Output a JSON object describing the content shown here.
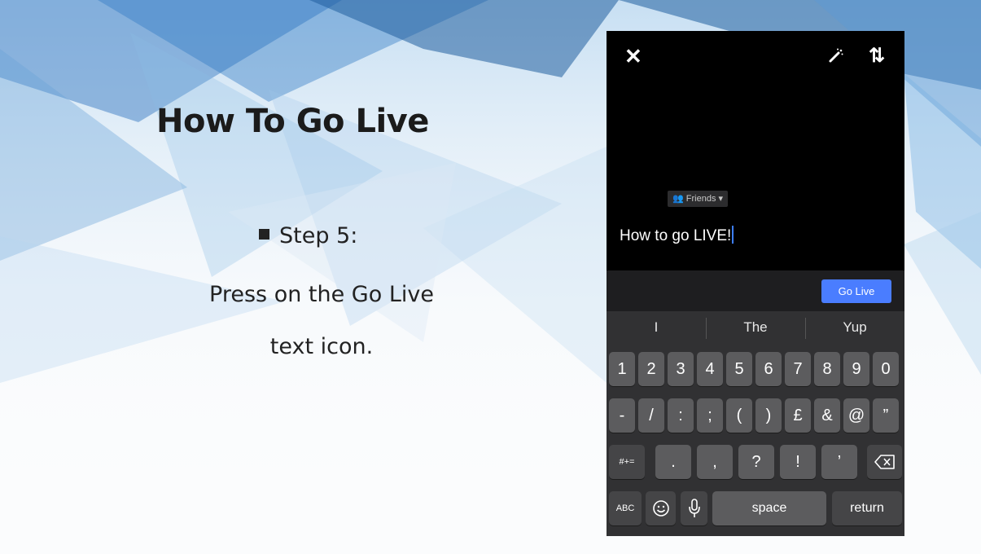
{
  "slide": {
    "title": "How To Go Live",
    "step_label": "Step 5:",
    "instruction_line1": "Press on the Go Live",
    "instruction_line2": "text icon."
  },
  "phone": {
    "audience_label": "Friends ▾",
    "caption_text": "How to go LIVE!",
    "go_live_label": "Go Live",
    "suggestions": [
      "I",
      "The",
      "Yup"
    ],
    "keyboard": {
      "row1": [
        "1",
        "2",
        "3",
        "4",
        "5",
        "6",
        "7",
        "8",
        "9",
        "0"
      ],
      "row2": [
        "-",
        "/",
        ":",
        ";",
        "(",
        ")",
        "£",
        "&",
        "@",
        "”"
      ],
      "row3_left": "#+=",
      "row3": [
        ".",
        ",",
        "?",
        "!",
        "’"
      ],
      "abc_label": "ABC",
      "space_label": "space",
      "return_label": "return"
    }
  },
  "colors": {
    "accent": "#4a7dff",
    "background_blue": "#2f79c4",
    "keyboard": "#313133"
  }
}
